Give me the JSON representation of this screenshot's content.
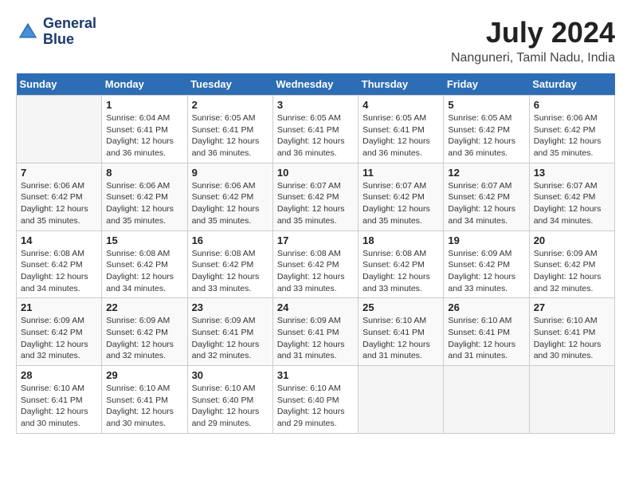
{
  "logo": {
    "line1": "General",
    "line2": "Blue"
  },
  "title": "July 2024",
  "location": "Nanguneri, Tamil Nadu, India",
  "header": {
    "days": [
      "Sunday",
      "Monday",
      "Tuesday",
      "Wednesday",
      "Thursday",
      "Friday",
      "Saturday"
    ]
  },
  "weeks": [
    [
      {
        "day": "",
        "sunrise": "",
        "sunset": "",
        "daylight": ""
      },
      {
        "day": "1",
        "sunrise": "Sunrise: 6:04 AM",
        "sunset": "Sunset: 6:41 PM",
        "daylight": "Daylight: 12 hours and 36 minutes."
      },
      {
        "day": "2",
        "sunrise": "Sunrise: 6:05 AM",
        "sunset": "Sunset: 6:41 PM",
        "daylight": "Daylight: 12 hours and 36 minutes."
      },
      {
        "day": "3",
        "sunrise": "Sunrise: 6:05 AM",
        "sunset": "Sunset: 6:41 PM",
        "daylight": "Daylight: 12 hours and 36 minutes."
      },
      {
        "day": "4",
        "sunrise": "Sunrise: 6:05 AM",
        "sunset": "Sunset: 6:41 PM",
        "daylight": "Daylight: 12 hours and 36 minutes."
      },
      {
        "day": "5",
        "sunrise": "Sunrise: 6:05 AM",
        "sunset": "Sunset: 6:42 PM",
        "daylight": "Daylight: 12 hours and 36 minutes."
      },
      {
        "day": "6",
        "sunrise": "Sunrise: 6:06 AM",
        "sunset": "Sunset: 6:42 PM",
        "daylight": "Daylight: 12 hours and 35 minutes."
      }
    ],
    [
      {
        "day": "7",
        "sunrise": "Sunrise: 6:06 AM",
        "sunset": "Sunset: 6:42 PM",
        "daylight": "Daylight: 12 hours and 35 minutes."
      },
      {
        "day": "8",
        "sunrise": "Sunrise: 6:06 AM",
        "sunset": "Sunset: 6:42 PM",
        "daylight": "Daylight: 12 hours and 35 minutes."
      },
      {
        "day": "9",
        "sunrise": "Sunrise: 6:06 AM",
        "sunset": "Sunset: 6:42 PM",
        "daylight": "Daylight: 12 hours and 35 minutes."
      },
      {
        "day": "10",
        "sunrise": "Sunrise: 6:07 AM",
        "sunset": "Sunset: 6:42 PM",
        "daylight": "Daylight: 12 hours and 35 minutes."
      },
      {
        "day": "11",
        "sunrise": "Sunrise: 6:07 AM",
        "sunset": "Sunset: 6:42 PM",
        "daylight": "Daylight: 12 hours and 35 minutes."
      },
      {
        "day": "12",
        "sunrise": "Sunrise: 6:07 AM",
        "sunset": "Sunset: 6:42 PM",
        "daylight": "Daylight: 12 hours and 34 minutes."
      },
      {
        "day": "13",
        "sunrise": "Sunrise: 6:07 AM",
        "sunset": "Sunset: 6:42 PM",
        "daylight": "Daylight: 12 hours and 34 minutes."
      }
    ],
    [
      {
        "day": "14",
        "sunrise": "Sunrise: 6:08 AM",
        "sunset": "Sunset: 6:42 PM",
        "daylight": "Daylight: 12 hours and 34 minutes."
      },
      {
        "day": "15",
        "sunrise": "Sunrise: 6:08 AM",
        "sunset": "Sunset: 6:42 PM",
        "daylight": "Daylight: 12 hours and 34 minutes."
      },
      {
        "day": "16",
        "sunrise": "Sunrise: 6:08 AM",
        "sunset": "Sunset: 6:42 PM",
        "daylight": "Daylight: 12 hours and 33 minutes."
      },
      {
        "day": "17",
        "sunrise": "Sunrise: 6:08 AM",
        "sunset": "Sunset: 6:42 PM",
        "daylight": "Daylight: 12 hours and 33 minutes."
      },
      {
        "day": "18",
        "sunrise": "Sunrise: 6:08 AM",
        "sunset": "Sunset: 6:42 PM",
        "daylight": "Daylight: 12 hours and 33 minutes."
      },
      {
        "day": "19",
        "sunrise": "Sunrise: 6:09 AM",
        "sunset": "Sunset: 6:42 PM",
        "daylight": "Daylight: 12 hours and 33 minutes."
      },
      {
        "day": "20",
        "sunrise": "Sunrise: 6:09 AM",
        "sunset": "Sunset: 6:42 PM",
        "daylight": "Daylight: 12 hours and 32 minutes."
      }
    ],
    [
      {
        "day": "21",
        "sunrise": "Sunrise: 6:09 AM",
        "sunset": "Sunset: 6:42 PM",
        "daylight": "Daylight: 12 hours and 32 minutes."
      },
      {
        "day": "22",
        "sunrise": "Sunrise: 6:09 AM",
        "sunset": "Sunset: 6:42 PM",
        "daylight": "Daylight: 12 hours and 32 minutes."
      },
      {
        "day": "23",
        "sunrise": "Sunrise: 6:09 AM",
        "sunset": "Sunset: 6:41 PM",
        "daylight": "Daylight: 12 hours and 32 minutes."
      },
      {
        "day": "24",
        "sunrise": "Sunrise: 6:09 AM",
        "sunset": "Sunset: 6:41 PM",
        "daylight": "Daylight: 12 hours and 31 minutes."
      },
      {
        "day": "25",
        "sunrise": "Sunrise: 6:10 AM",
        "sunset": "Sunset: 6:41 PM",
        "daylight": "Daylight: 12 hours and 31 minutes."
      },
      {
        "day": "26",
        "sunrise": "Sunrise: 6:10 AM",
        "sunset": "Sunset: 6:41 PM",
        "daylight": "Daylight: 12 hours and 31 minutes."
      },
      {
        "day": "27",
        "sunrise": "Sunrise: 6:10 AM",
        "sunset": "Sunset: 6:41 PM",
        "daylight": "Daylight: 12 hours and 30 minutes."
      }
    ],
    [
      {
        "day": "28",
        "sunrise": "Sunrise: 6:10 AM",
        "sunset": "Sunset: 6:41 PM",
        "daylight": "Daylight: 12 hours and 30 minutes."
      },
      {
        "day": "29",
        "sunrise": "Sunrise: 6:10 AM",
        "sunset": "Sunset: 6:41 PM",
        "daylight": "Daylight: 12 hours and 30 minutes."
      },
      {
        "day": "30",
        "sunrise": "Sunrise: 6:10 AM",
        "sunset": "Sunset: 6:40 PM",
        "daylight": "Daylight: 12 hours and 29 minutes."
      },
      {
        "day": "31",
        "sunrise": "Sunrise: 6:10 AM",
        "sunset": "Sunset: 6:40 PM",
        "daylight": "Daylight: 12 hours and 29 minutes."
      },
      {
        "day": "",
        "sunrise": "",
        "sunset": "",
        "daylight": ""
      },
      {
        "day": "",
        "sunrise": "",
        "sunset": "",
        "daylight": ""
      },
      {
        "day": "",
        "sunrise": "",
        "sunset": "",
        "daylight": ""
      }
    ]
  ]
}
